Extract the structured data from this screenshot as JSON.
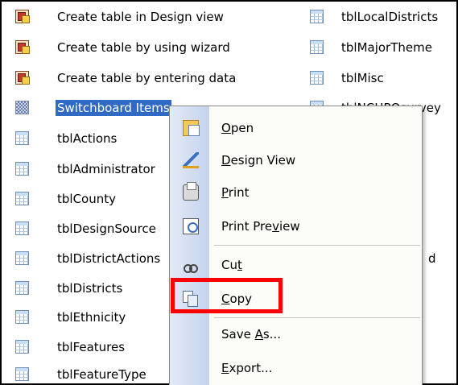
{
  "left_list": [
    {
      "label": "Create table in Design view",
      "icon": "wizard-icon"
    },
    {
      "label": "Create table by using wizard",
      "icon": "wizard-icon"
    },
    {
      "label": "Create table by entering data",
      "icon": "wizard-icon"
    },
    {
      "label": "Switchboard Items",
      "icon": "switchboard-table-icon",
      "selected": true
    },
    {
      "label": "tblActions",
      "icon": "table-icon"
    },
    {
      "label": "tblAdministrator",
      "icon": "table-icon"
    },
    {
      "label": "tblCounty",
      "icon": "table-icon"
    },
    {
      "label": "tblDesignSource",
      "icon": "table-icon"
    },
    {
      "label": "tblDistrictActions",
      "icon": "table-icon"
    },
    {
      "label": "tblDistricts",
      "icon": "table-icon"
    },
    {
      "label": "tblEthnicity",
      "icon": "table-icon"
    },
    {
      "label": "tblFeatures",
      "icon": "table-icon"
    },
    {
      "label": "tblFeatureType",
      "icon": "table-icon"
    }
  ],
  "right_list": [
    {
      "label": "tblLocalDistricts",
      "icon": "table-icon"
    },
    {
      "label": "tblMajorTheme",
      "icon": "table-icon"
    },
    {
      "label": "tblMisc",
      "icon": "table-icon"
    },
    {
      "label": "tblNCHPOsurvey",
      "icon": "table-icon"
    }
  ],
  "occluded_fragment": "d",
  "context_menu": {
    "items": [
      {
        "pre": "",
        "u": "O",
        "post": "pen",
        "icon": "open-icon"
      },
      {
        "pre": "",
        "u": "D",
        "post": "esign View",
        "icon": "design-view-icon"
      },
      {
        "pre": "",
        "u": "P",
        "post": "rint",
        "icon": "print-icon"
      },
      {
        "pre": "Print Pre",
        "u": "v",
        "post": "iew",
        "icon": "print-preview-icon"
      },
      {
        "pre": "Cu",
        "u": "t",
        "post": "",
        "icon": "cut-icon"
      },
      {
        "pre": "",
        "u": "C",
        "post": "opy",
        "icon": "copy-icon"
      },
      {
        "pre": "Save ",
        "u": "A",
        "post": "s...",
        "icon": ""
      },
      {
        "pre": "",
        "u": "E",
        "post": "xport...",
        "icon": ""
      }
    ]
  },
  "colors": {
    "selection": "#316ac5",
    "highlight_box": "#ff0000",
    "menu_gutter": "#c5d3ee"
  }
}
